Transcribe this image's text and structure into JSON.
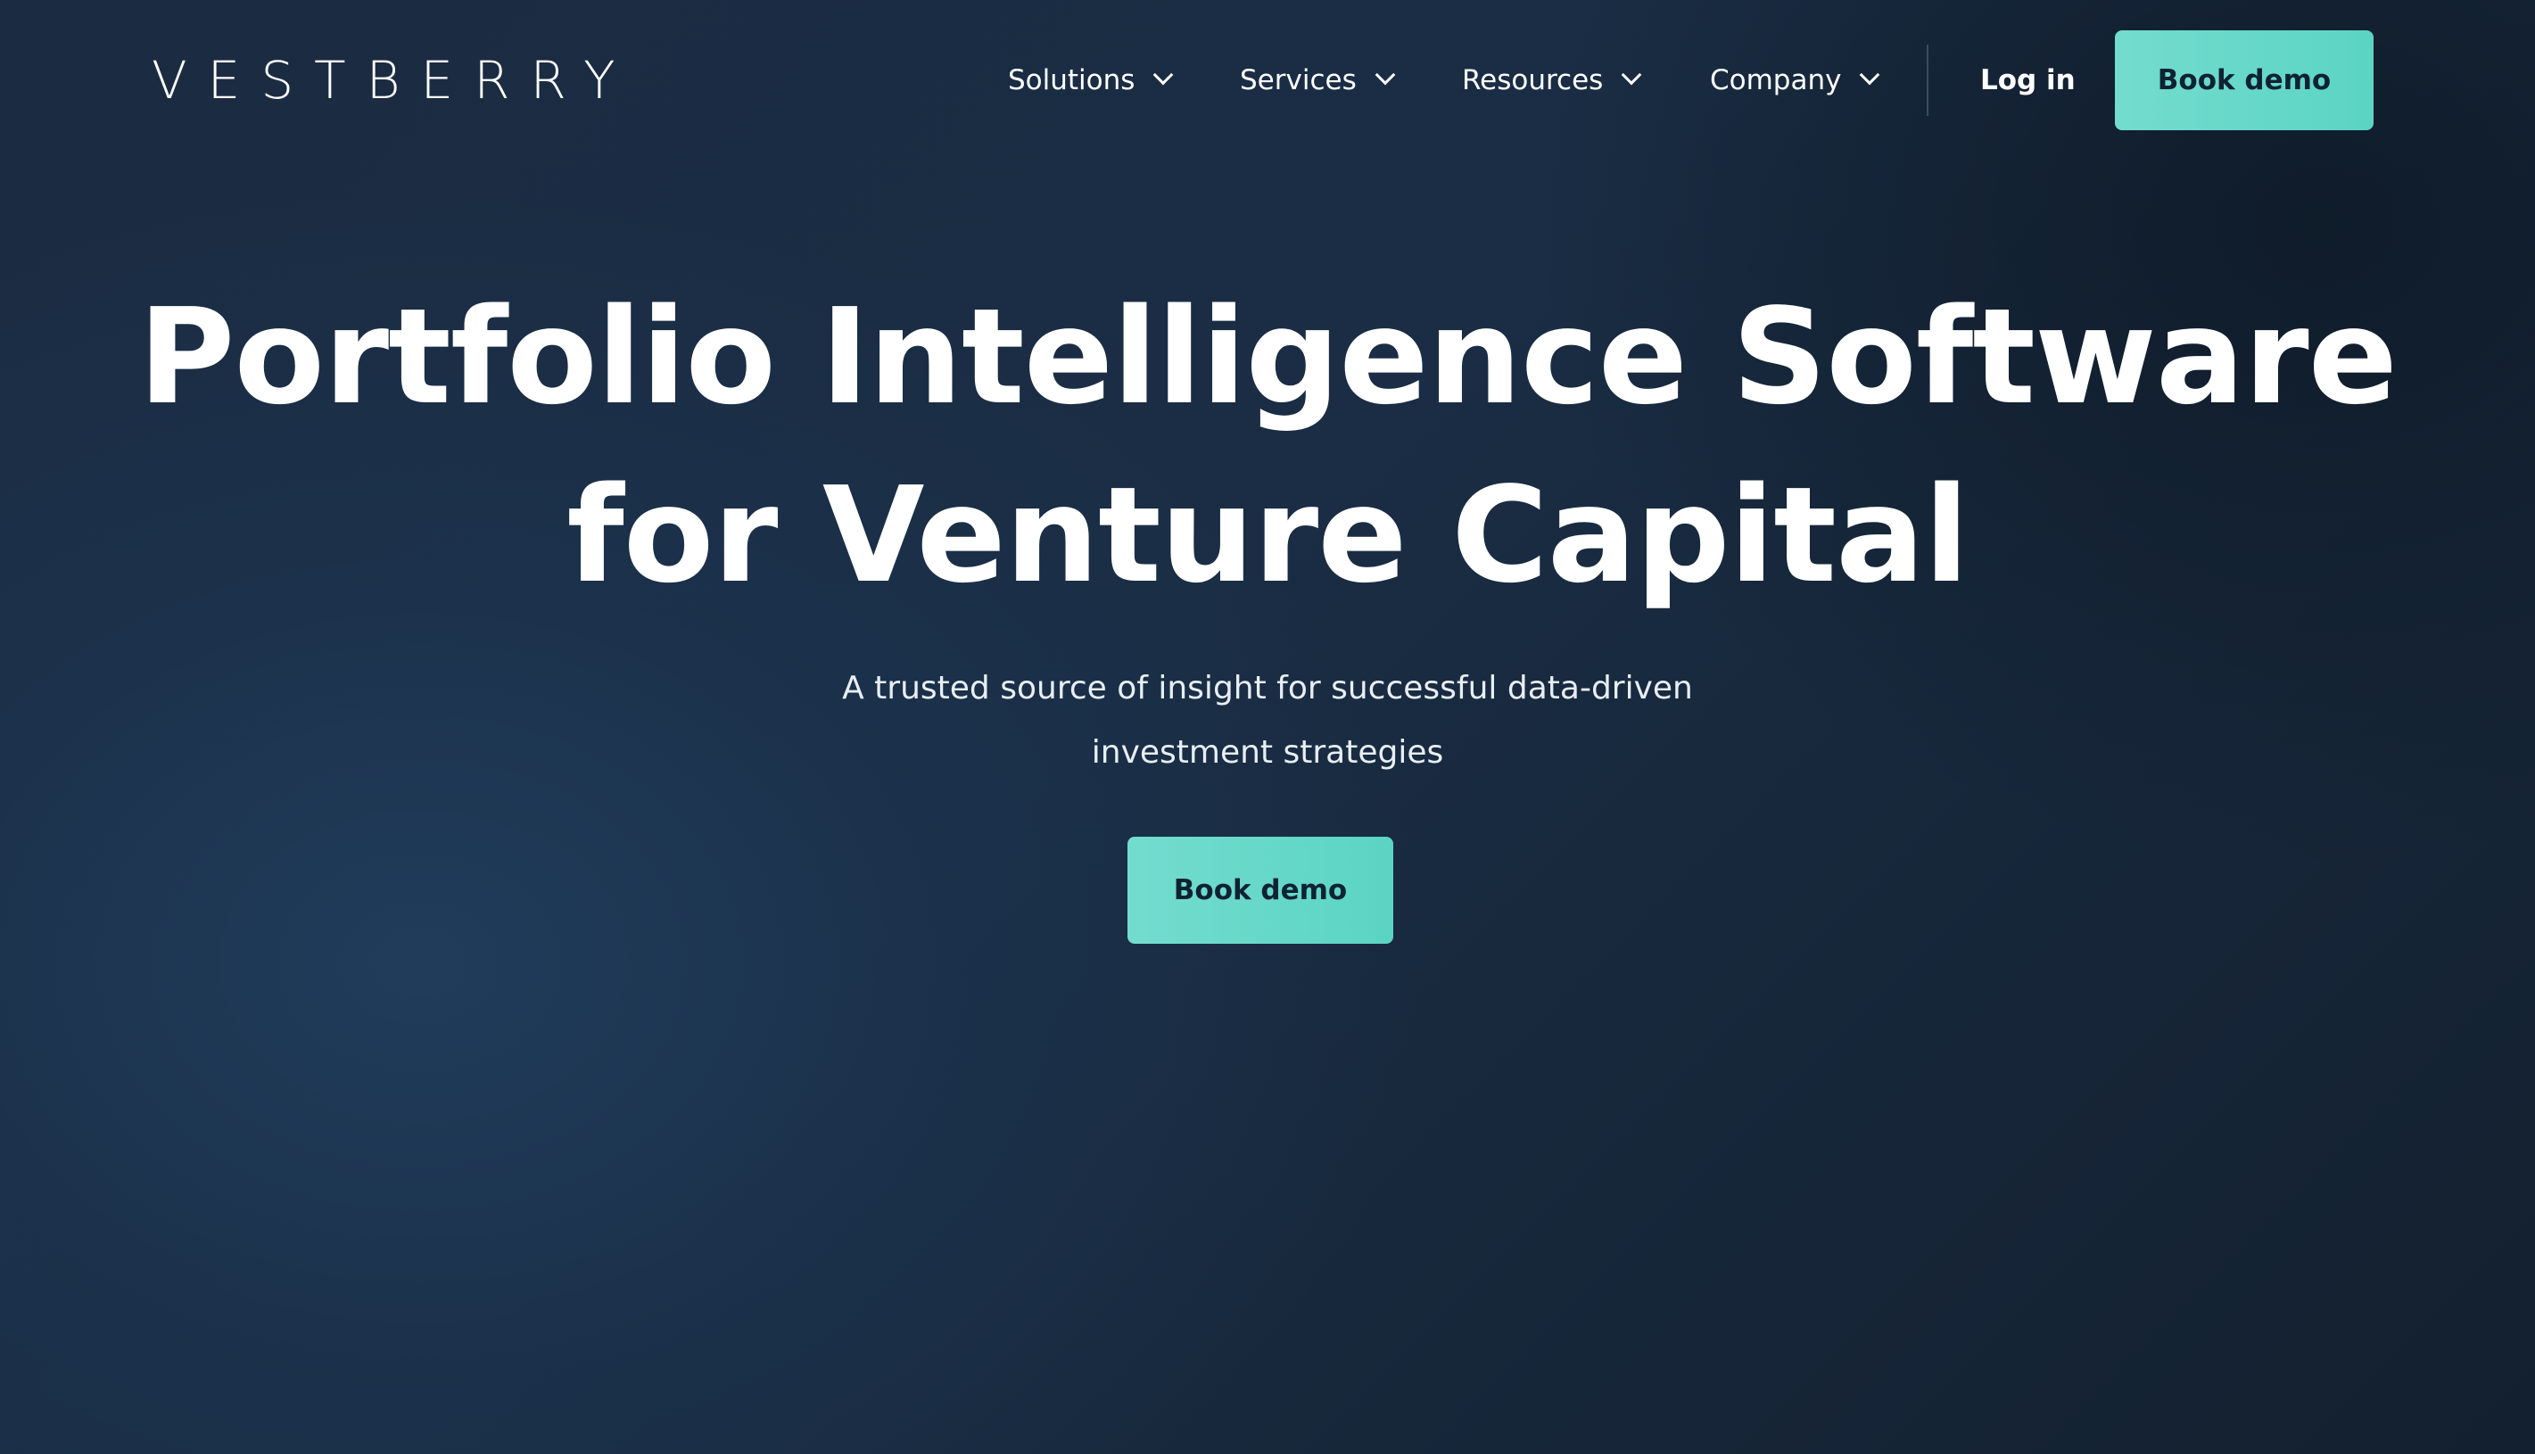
{
  "header": {
    "logo": "VESTBERRY",
    "nav": [
      {
        "label": "Solutions",
        "icon": "chevron-down-icon"
      },
      {
        "label": "Services",
        "icon": "chevron-down-icon"
      },
      {
        "label": "Resources",
        "icon": "chevron-down-icon"
      },
      {
        "label": "Company",
        "icon": "chevron-down-icon"
      }
    ],
    "login_label": "Log in",
    "demo_label": "Book demo"
  },
  "hero": {
    "title_lines": [
      "Portfolio Intelligence Software",
      "for Venture Capital"
    ],
    "subtitle_lines": [
      "A trusted source of insight for successful data-driven",
      "investment strategies"
    ],
    "cta_label": "Book demo"
  },
  "colors": {
    "background": "#1a2d44",
    "accent": "#66d8ca",
    "button_text": "#0f2234",
    "divider": "#3a4c61"
  }
}
